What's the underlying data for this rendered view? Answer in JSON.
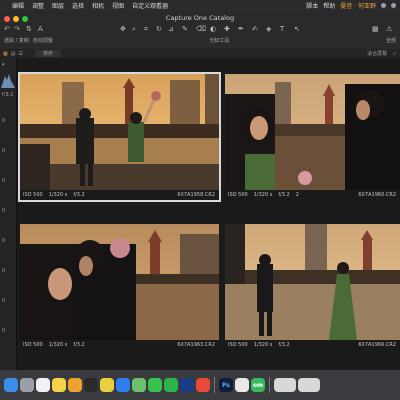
{
  "menubar": {
    "items": [
      "编辑",
      "调整",
      "图层",
      "选择",
      "相机",
      "视图",
      "自定义观看器"
    ],
    "right_items": [
      "脚本",
      "帮助"
    ],
    "user": "晏音 · 何亚野"
  },
  "window": {
    "title": "Capture One Catalog",
    "left_label_1": "选取 / 复制",
    "left_label_2": "自动调整",
    "center_label": "光标工具",
    "right_label": "全部",
    "fit_label": "适合屏幕",
    "sort_label": "排序"
  },
  "photos": [
    {
      "iso": "ISO 500",
      "shutter": "1/320 s",
      "aperture": "f/3.2",
      "filename": "6X7A1958.CR2",
      "selected": true,
      "rating": ""
    },
    {
      "iso": "ISO 500",
      "shutter": "1/320 s",
      "aperture": "f/3.2",
      "filename": "6X7A1960.CR2",
      "selected": false,
      "rating": "2"
    },
    {
      "iso": "ISO 500",
      "shutter": "1/320 s",
      "aperture": "f/3.2",
      "filename": "6X7A1963.CR2",
      "selected": false,
      "rating": ""
    },
    {
      "iso": "ISO 500",
      "shutter": "1/320 s",
      "aperture": "f/3.2",
      "filename": "6X7A1966.CR2",
      "selected": false,
      "rating": ""
    }
  ],
  "left_panel": {
    "values": [
      "f/3.2",
      "0",
      "0",
      "0",
      "0",
      "0",
      "0",
      "0",
      "0"
    ]
  },
  "dock": {
    "apps": [
      "finder-icon",
      "launchpad-icon",
      "reminders-icon",
      "notes-icon",
      "pencil-icon",
      "music-icon",
      "chrome-icon",
      "app-store-icon",
      "maps-icon",
      "messages-icon",
      "wechat-icon",
      "qq-icon",
      "weibo-icon",
      "photoshop-icon",
      "vpn-icon",
      "settings-icon",
      "keyboard-icon"
    ],
    "ps_label": "Ps",
    "green_label": "om"
  },
  "colors": {
    "accent": "#e8a230",
    "selection": "#d9d9d9"
  }
}
